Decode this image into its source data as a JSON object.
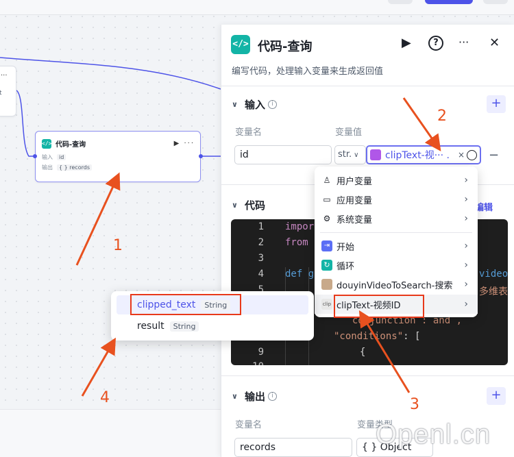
{
  "canvas": {
    "node_left": {
      "menu": "···",
      "label": "t"
    },
    "node": {
      "title": "代码-查询",
      "input_label": "输入",
      "input_chip": "id",
      "output_label": "输出",
      "output_chip": "{ } records"
    }
  },
  "panel": {
    "title": "代码-查询",
    "description": "编写代码，处理输入变量来生成返回值",
    "run_icon": "▶",
    "help_icon": "?",
    "more_icon": "···",
    "close_icon": "✕",
    "input_section": {
      "title": "输入",
      "add": "+",
      "col_name": "变量名",
      "col_value": "变量值",
      "name_value": "id",
      "type_value": "str.",
      "ref_value": "clipText-视··· .",
      "clear": "×",
      "remove": "−"
    },
    "code_section": {
      "title": "代码",
      "edit_link": "编辑",
      "lines": [
        {
          "n": "1",
          "text": "impor"
        },
        {
          "n": "2",
          "text": "from"
        },
        {
          "n": "3",
          "text": ""
        },
        {
          "n": "4",
          "text": "def g"
        },
        {
          "n": "5",
          "text": ""
        },
        {
          "n": "",
          "text": "  conjunction : and ,"
        },
        {
          "n": "",
          "text": "\"conditions\": ["
        },
        {
          "n": "9",
          "text": "{"
        },
        {
          "n": "10",
          "text": ""
        }
      ],
      "right_fragments": [
        "video_",
        "多维表"
      ]
    },
    "output_section": {
      "title": "输出",
      "add": "+",
      "col_name": "变量名",
      "col_type": "变量类型",
      "name_value": "records",
      "type_value": "{ } Object"
    }
  },
  "var_menu": {
    "items": [
      {
        "label": "用户变量",
        "icon": "person-icon"
      },
      {
        "label": "应用变量",
        "icon": "folder-icon"
      },
      {
        "label": "系统变量",
        "icon": "gear-icon"
      },
      {
        "label": "开始",
        "icon": "start-icon"
      },
      {
        "label": "循环",
        "icon": "loop-icon"
      },
      {
        "label": "douyinVideoToSearch-搜索",
        "icon": "avatar-icon"
      },
      {
        "label": "clipText-视频ID",
        "icon": "cliptext-icon"
      }
    ]
  },
  "sub_menu": {
    "items": [
      {
        "label": "clipped_text",
        "type": "String"
      },
      {
        "label": "result",
        "type": "String"
      }
    ]
  },
  "annotations": {
    "n1": "1",
    "n2": "2",
    "n3": "3",
    "n4": "4"
  },
  "watermark": "Openl.cn",
  "colors": {
    "accent": "#4d53e8",
    "teal": "#13b4a6",
    "annotation_red": "#e8391a"
  }
}
